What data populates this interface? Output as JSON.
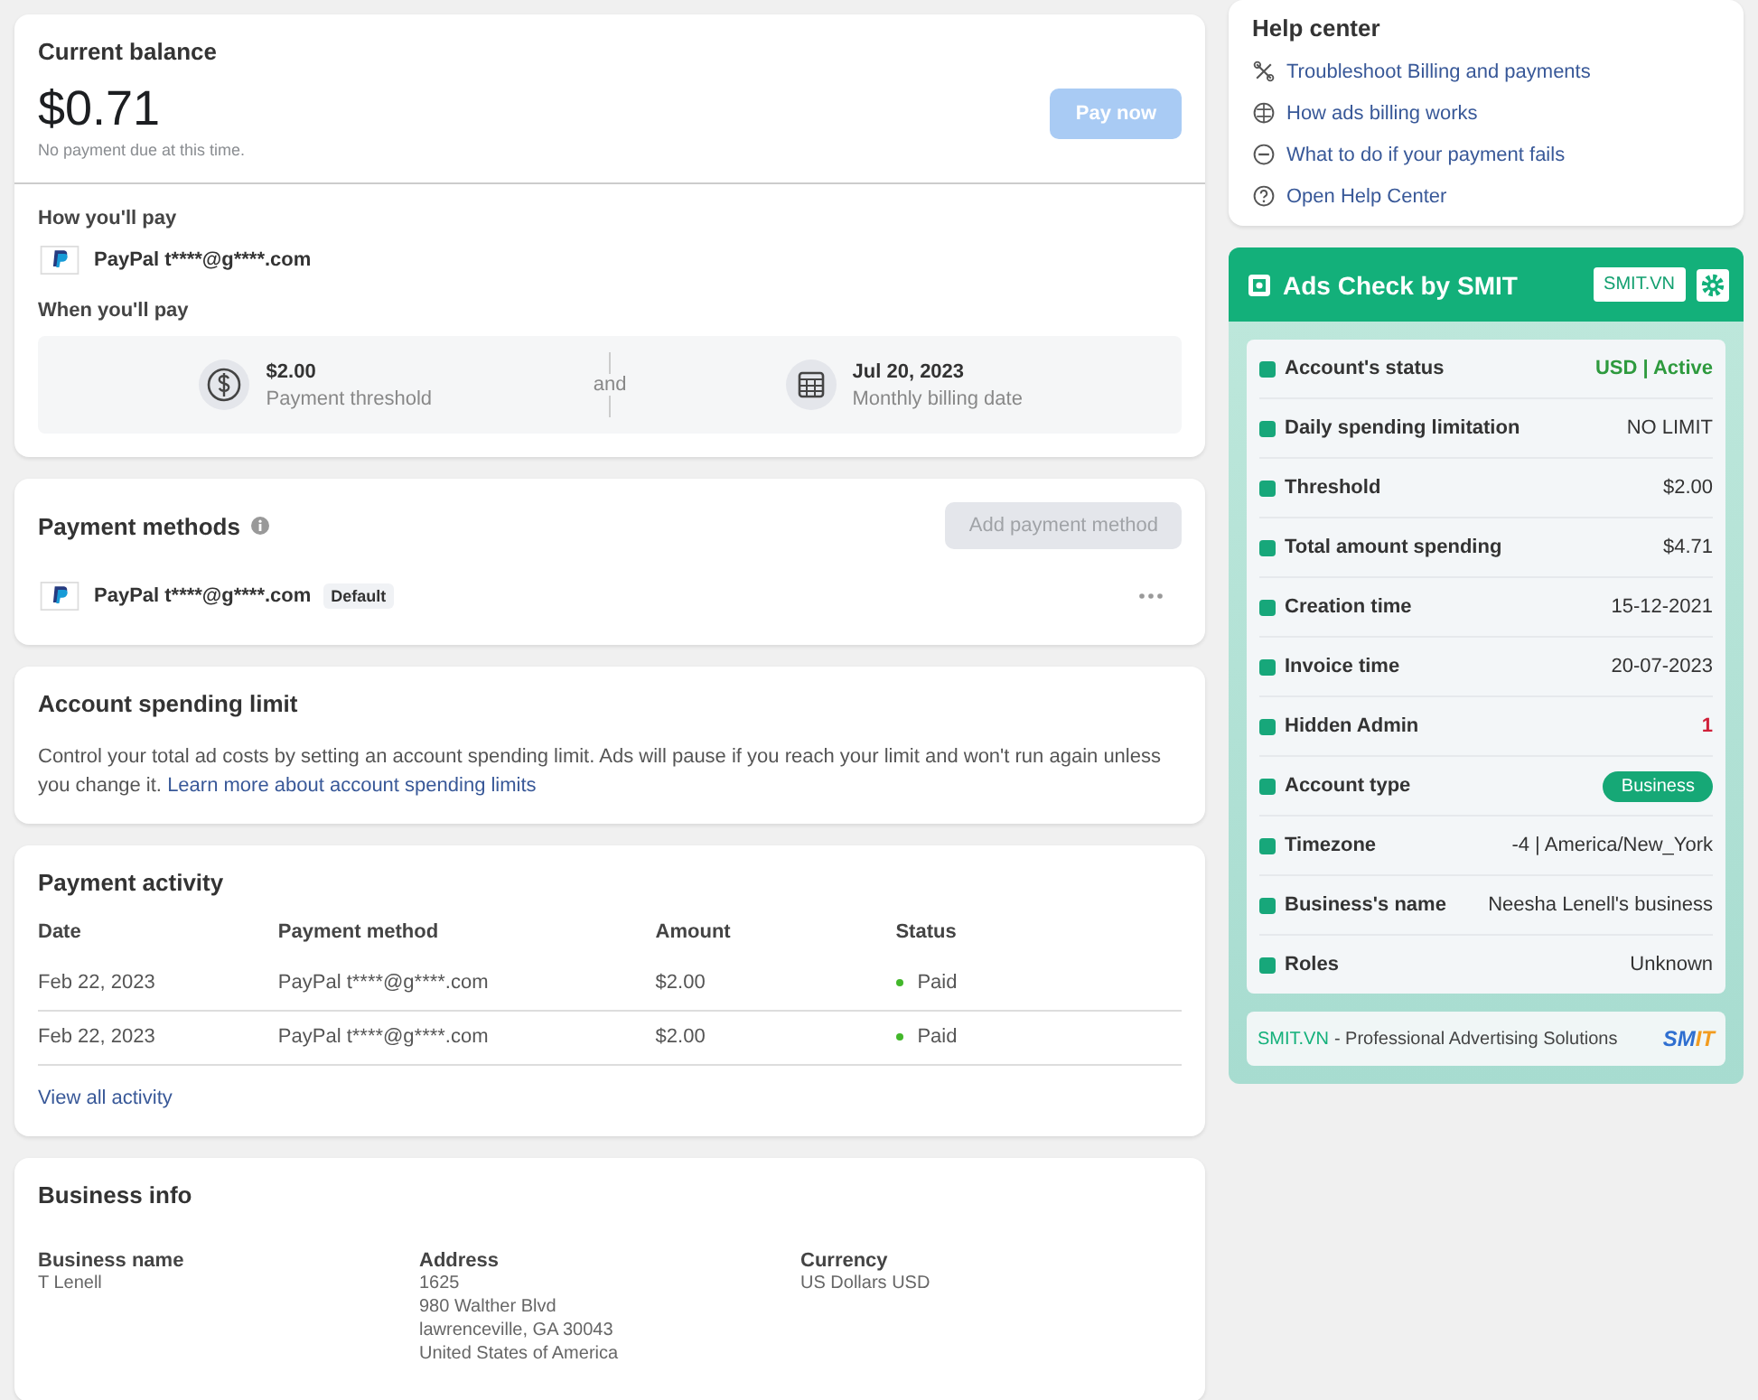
{
  "balance": {
    "title": "Current balance",
    "amount": "$0.71",
    "note": "No payment due at this time.",
    "pay_button": {
      "label": "Pay now",
      "disabled": true
    },
    "how_label": "How you'll pay",
    "method": "PayPal t****@g****.com",
    "when_label": "When you'll pay",
    "threshold": {
      "value": "$2.00",
      "label": "Payment threshold"
    },
    "joiner": "and",
    "billing_date": {
      "value": "Jul 20, 2023",
      "label": "Monthly billing date"
    }
  },
  "payment_methods": {
    "title": "Payment methods",
    "add_button": {
      "label": "Add payment method",
      "disabled": true
    },
    "method": "PayPal t****@g****.com",
    "badge": "Default"
  },
  "spending_limit": {
    "title": "Account spending limit",
    "text": "Control your total ad costs by setting an account spending limit. Ads will pause if you reach your limit and won't run again unless you change it.",
    "link": "Learn more about account spending limits"
  },
  "payment_activity": {
    "title": "Payment activity",
    "columns": [
      "Date",
      "Payment method",
      "Amount",
      "Status"
    ],
    "rows": [
      {
        "date": "Feb 22, 2023",
        "method": "PayPal t****@g****.com",
        "amount": "$2.00",
        "status": "Paid",
        "color": "#42b72a"
      },
      {
        "date": "Feb 22, 2023",
        "method": "PayPal t****@g****.com",
        "amount": "$2.00",
        "status": "Paid",
        "color": "#42b72a"
      }
    ],
    "link": "View all activity"
  },
  "business_info": {
    "title": "Business info",
    "fields": [
      {
        "label": "Business name",
        "lines": [
          "T Lenell"
        ]
      },
      {
        "label": "Address",
        "lines": [
          "1625",
          "980 Walther Blvd",
          "lawrenceville, GA 30043",
          "United States of America"
        ]
      },
      {
        "label": "Currency",
        "lines": [
          "US Dollars USD"
        ]
      }
    ]
  },
  "help_center": {
    "title": "Help center",
    "links": [
      {
        "kind": "wrench",
        "label": "Troubleshoot Billing and payments"
      },
      {
        "kind": "globe",
        "label": "How ads billing works"
      },
      {
        "kind": "minus",
        "label": "What to do if your payment fails"
      },
      {
        "kind": "question",
        "label": "Open Help Center"
      }
    ]
  },
  "ads_check": {
    "title": "Ads Check by SMIT",
    "site_button": "SMIT.VN",
    "rows": [
      {
        "label": "Account's status",
        "value": "USD | Active",
        "kind": "status"
      },
      {
        "label": "Daily spending limitation",
        "value": "NO LIMIT",
        "kind": "text"
      },
      {
        "label": "Threshold",
        "value": "$2.00",
        "kind": "text"
      },
      {
        "label": "Total amount spending",
        "value": "$4.71",
        "kind": "text"
      },
      {
        "label": "Creation time",
        "value": "15-12-2021",
        "kind": "text"
      },
      {
        "label": "Invoice time",
        "value": "20-07-2023",
        "kind": "text"
      },
      {
        "label": "Hidden Admin",
        "value": "1",
        "kind": "alert"
      },
      {
        "label": "Account type",
        "value": "Business",
        "kind": "pill"
      },
      {
        "label": "Timezone",
        "value": "-4 | America/New_York",
        "kind": "text"
      },
      {
        "label": "Business's name",
        "value": "Neesha Lenell's business",
        "kind": "text"
      },
      {
        "label": "Roles",
        "value": "Unknown",
        "kind": "text"
      }
    ],
    "footer_brand": "SMIT.VN",
    "footer_text": "- Professional Advertising Solutions",
    "logo": "SMIT"
  }
}
